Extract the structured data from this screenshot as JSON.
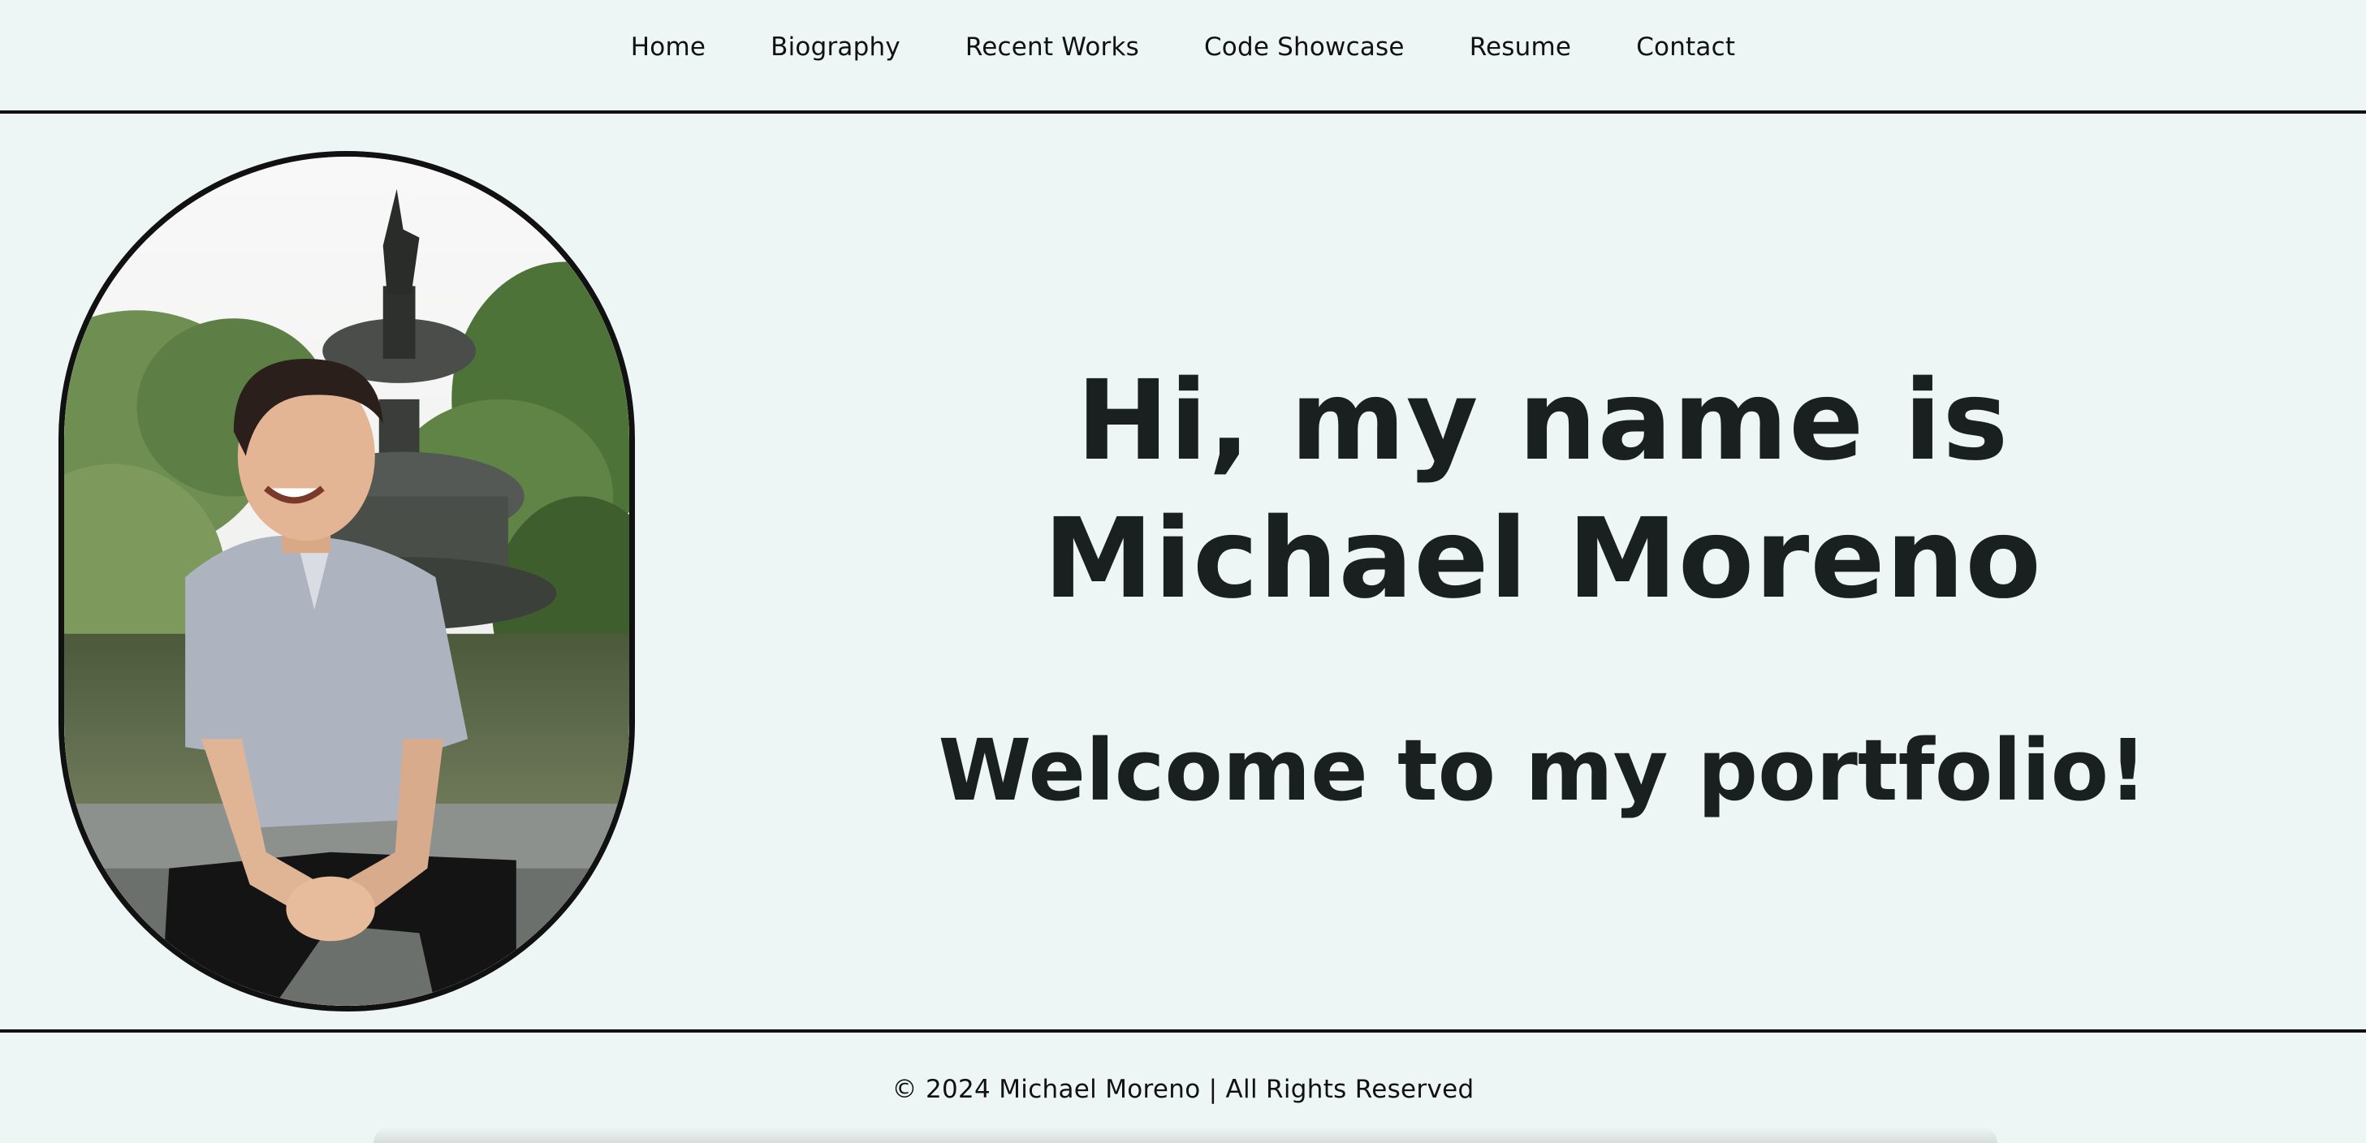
{
  "nav": {
    "items": [
      {
        "label": "Home"
      },
      {
        "label": "Biography"
      },
      {
        "label": "Recent Works"
      },
      {
        "label": "Code Showcase"
      },
      {
        "label": "Resume"
      },
      {
        "label": "Contact"
      }
    ]
  },
  "hero": {
    "title_line1": "Hi, my name is",
    "title_line2": "Michael Moreno",
    "subtitle": "Welcome to my portfolio!"
  },
  "footer": {
    "text": "© 2024 Michael Moreno | All Rights Reserved"
  },
  "colors": {
    "background": "#eef6f5",
    "text": "#1a1f1f",
    "border": "#111111"
  }
}
